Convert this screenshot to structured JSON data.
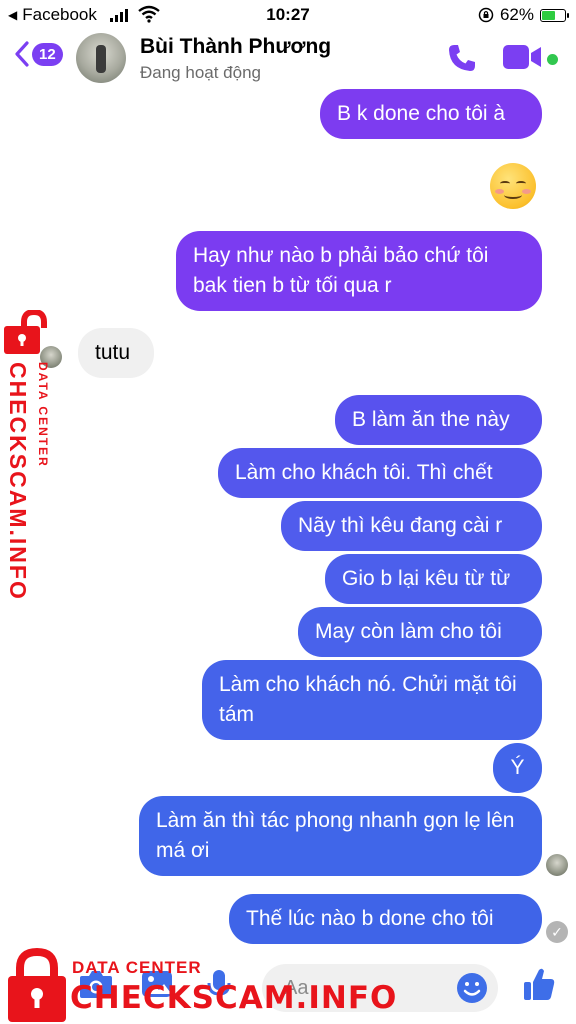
{
  "status_bar": {
    "back_app": "Facebook",
    "time": "10:27",
    "battery_percent": "62%",
    "battery_level": 0.62
  },
  "header": {
    "unread_count": "12",
    "contact_name": "Bùi Thành Phương",
    "contact_status": "Đang hoạt động"
  },
  "messages": [
    {
      "dir": "out",
      "text": "B k done cho tôi à"
    },
    {
      "dir": "out",
      "text": "☺",
      "type": "emoji"
    },
    {
      "dir": "out",
      "text": "Hay như nào b phải bảo chứ tôi bak tien b từ tối qua r"
    },
    {
      "dir": "in",
      "text": "tutu"
    },
    {
      "dir": "out",
      "text": "B làm ăn the này"
    },
    {
      "dir": "out",
      "text": "Làm cho khách tôi. Thì chết"
    },
    {
      "dir": "out",
      "text": "Nãy thì kêu đang cài r"
    },
    {
      "dir": "out",
      "text": "Gio b lại kêu từ từ"
    },
    {
      "dir": "out",
      "text": "May còn làm cho tôi"
    },
    {
      "dir": "out",
      "text": "Làm cho khách nó. Chửi mặt tôi tám"
    },
    {
      "dir": "out",
      "text": "Ý"
    },
    {
      "dir": "out",
      "text": "Làm ăn thì tác phong nhanh gọn lẹ lên má ơi"
    },
    {
      "dir": "out",
      "text": "Thế lúc nào b done cho tôi"
    }
  ],
  "composer": {
    "placeholder": "Aa"
  },
  "watermark": {
    "brand": "CHECKSCAM.INFO",
    "tagline": "DATA CENTER"
  },
  "colors": {
    "accent": "#7b3ff2",
    "bubble_purple": "#7d3cf0",
    "bubble_blue": "#3f64e8",
    "online": "#31c74f",
    "watermark_red": "#e8141b"
  }
}
